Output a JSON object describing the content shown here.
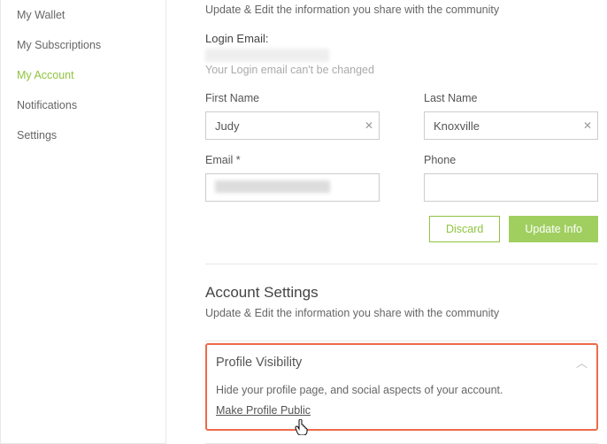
{
  "sidebar": {
    "items": [
      {
        "label": "My Wallet"
      },
      {
        "label": "My Subscriptions"
      },
      {
        "label": "My Account"
      },
      {
        "label": "Notifications"
      },
      {
        "label": "Settings"
      }
    ]
  },
  "main": {
    "subtitle": "Update & Edit the information you share with the community",
    "login_email": {
      "label": "Login Email:",
      "hint": "Your Login email can't be changed"
    },
    "fields": {
      "first_name": {
        "label": "First Name",
        "value": "Judy"
      },
      "last_name": {
        "label": "Last Name",
        "value": "Knoxville"
      },
      "email": {
        "label": "Email *"
      },
      "phone": {
        "label": "Phone",
        "value": ""
      }
    },
    "actions": {
      "discard": "Discard",
      "update": "Update Info"
    }
  },
  "account_settings": {
    "title": "Account Settings",
    "subtitle": "Update & Edit the information you share with the community",
    "profile_visibility": {
      "title": "Profile Visibility",
      "desc": "Hide your profile page, and social aspects of your account.",
      "link": "Make Profile Public"
    }
  }
}
